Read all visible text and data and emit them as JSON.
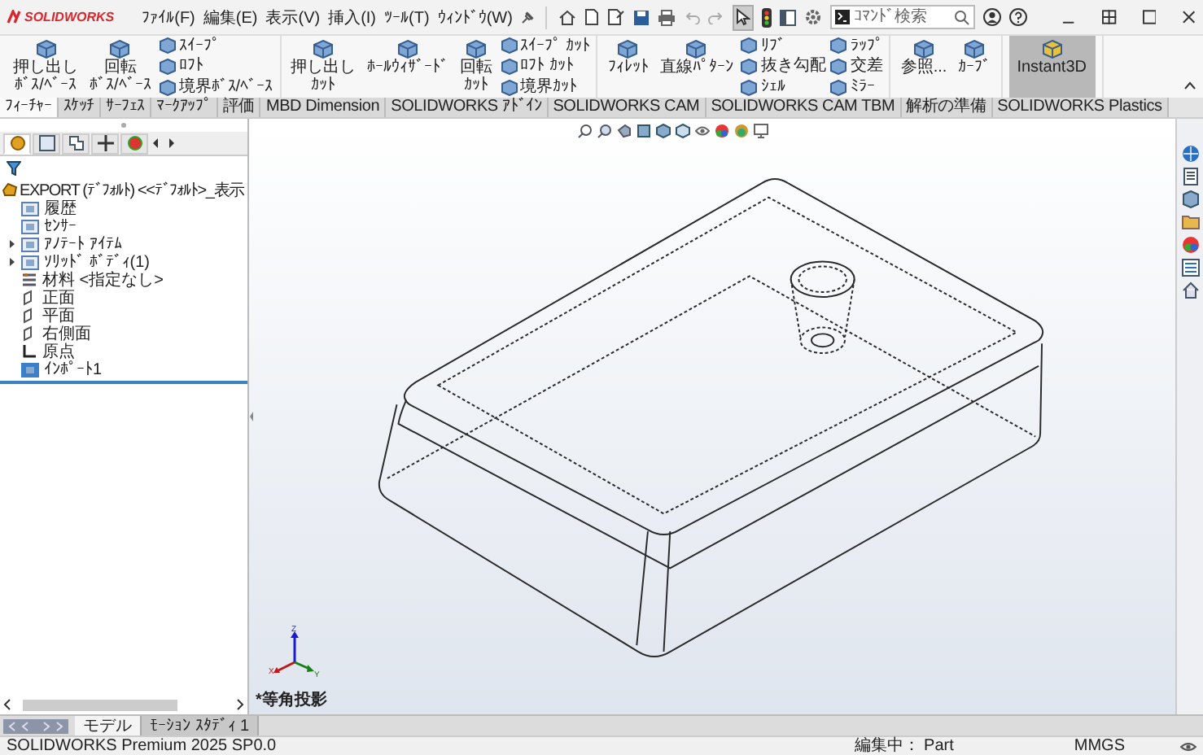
{
  "app": {
    "name": "SOLIDWORKS"
  },
  "menu": [
    "ﾌｧｲﾙ(F)",
    "編集(E)",
    "表示(V)",
    "挿入(I)",
    "ﾂｰﾙ(T)",
    "ｳｨﾝﾄﾞｳ(W)"
  ],
  "search": {
    "placeholder": "ｺﾏﾝﾄﾞ検索"
  },
  "ribbon": {
    "groups": [
      [
        {
          "kind": "large",
          "lines": [
            "押し出し",
            "ﾎﾞｽ/ﾍﾞｰｽ"
          ],
          "on": false
        },
        {
          "kind": "large",
          "lines": [
            "回転",
            "ﾎﾞｽ/ﾍﾞｰｽ"
          ],
          "on": false
        },
        {
          "kind": "stack",
          "items": [
            "ｽｲｰﾌﾟ",
            "ﾛﾌﾄ",
            "境界ﾎﾞｽ/ﾍﾞｰｽ"
          ]
        }
      ],
      [
        {
          "kind": "large",
          "lines": [
            "押し出し",
            "ｶｯﾄ"
          ],
          "on": false
        },
        {
          "kind": "large",
          "lines": [
            "ﾎｰﾙｳｨｻﾞｰﾄﾞ"
          ],
          "on": false
        },
        {
          "kind": "large",
          "lines": [
            "回転",
            "ｶｯﾄ"
          ],
          "on": false
        },
        {
          "kind": "stack",
          "items": [
            "ｽｲｰﾌﾟ ｶｯﾄ",
            "ﾛﾌﾄ ｶｯﾄ",
            "境界ｶｯﾄ"
          ]
        }
      ],
      [
        {
          "kind": "large",
          "lines": [
            "ﾌｨﾚｯﾄ"
          ],
          "on": false
        },
        {
          "kind": "large",
          "lines": [
            "直線ﾊﾟﾀｰﾝ"
          ],
          "on": false
        },
        {
          "kind": "stack",
          "items": [
            "ﾘﾌﾞ",
            "抜き勾配",
            "ｼｪﾙ"
          ]
        },
        {
          "kind": "stack",
          "items": [
            "ﾗｯﾌﾟ",
            "交差",
            "ﾐﾗｰ"
          ]
        }
      ],
      [
        {
          "kind": "large",
          "lines": [
            "参照..."
          ],
          "on": false
        },
        {
          "kind": "large",
          "lines": [
            "ｶｰﾌﾞ"
          ],
          "on": false
        }
      ],
      [
        {
          "kind": "large",
          "lines": [
            "Instant3D"
          ],
          "on": true
        }
      ]
    ]
  },
  "tabs": [
    {
      "label": "ﾌｨｰﾁｬｰ",
      "selected": true
    },
    {
      "label": "ｽｹｯﾁ",
      "selected": false
    },
    {
      "label": "ｻｰﾌｪｽ",
      "selected": false
    },
    {
      "label": "ﾏｰｸｱｯﾌﾟ",
      "selected": false
    },
    {
      "label": "評価",
      "selected": false
    },
    {
      "label": "MBD Dimension",
      "selected": false
    },
    {
      "label": "SOLIDWORKS ｱﾄﾞｲﾝ",
      "selected": false
    },
    {
      "label": "SOLIDWORKS CAM",
      "selected": false
    },
    {
      "label": "SOLIDWORKS CAM TBM",
      "selected": false
    },
    {
      "label": "解析の準備",
      "selected": false
    },
    {
      "label": "SOLIDWORKS Plastics",
      "selected": false
    }
  ],
  "panel_tabs": [
    {
      "kind": "feature",
      "selected": true
    },
    {
      "kind": "property",
      "selected": false
    },
    {
      "kind": "config",
      "selected": false
    },
    {
      "kind": "dimension",
      "selected": false
    },
    {
      "kind": "display",
      "selected": false
    }
  ],
  "tree": {
    "label": "EXPORT (ﾃﾞﾌｫﾙﾄ) <<ﾃﾞﾌｫﾙﾄ>_表示",
    "children": [
      {
        "kind": "history",
        "label": "履歴",
        "expandable": false
      },
      {
        "kind": "sensor",
        "label": "ｾﾝｻｰ",
        "expandable": false
      },
      {
        "kind": "annotation",
        "label": "ｱﾉﾃｰﾄ ｱｲﾃﾑ",
        "expandable": true
      },
      {
        "kind": "solid",
        "label": "ｿﾘｯﾄﾞ ﾎﾞﾃﾞｨ(1)",
        "expandable": true
      },
      {
        "kind": "material",
        "label": "材料 <指定なし>",
        "expandable": false
      },
      {
        "kind": "plane",
        "label": "正面",
        "expandable": false
      },
      {
        "kind": "plane",
        "label": "平面",
        "expandable": false
      },
      {
        "kind": "plane",
        "label": "右側面",
        "expandable": false
      },
      {
        "kind": "origin",
        "label": "原点",
        "expandable": false
      },
      {
        "kind": "import",
        "label": "ｲﾝﾎﾟｰﾄ1",
        "expandable": false
      }
    ]
  },
  "viewport": {
    "view_label": "*等角投影",
    "triad": {
      "x": "X",
      "y": "Y",
      "z": "Z"
    }
  },
  "bottom_tabs": [
    {
      "label": "モデル",
      "selected": true
    },
    {
      "label": "ﾓｰｼｮﾝ ｽﾀﾃﾞｨ 1",
      "selected": false
    }
  ],
  "status_bar": {
    "product": "SOLIDWORKS Premium 2025 SP0.0",
    "mode": "編集中： Part",
    "units": "MMGS"
  }
}
